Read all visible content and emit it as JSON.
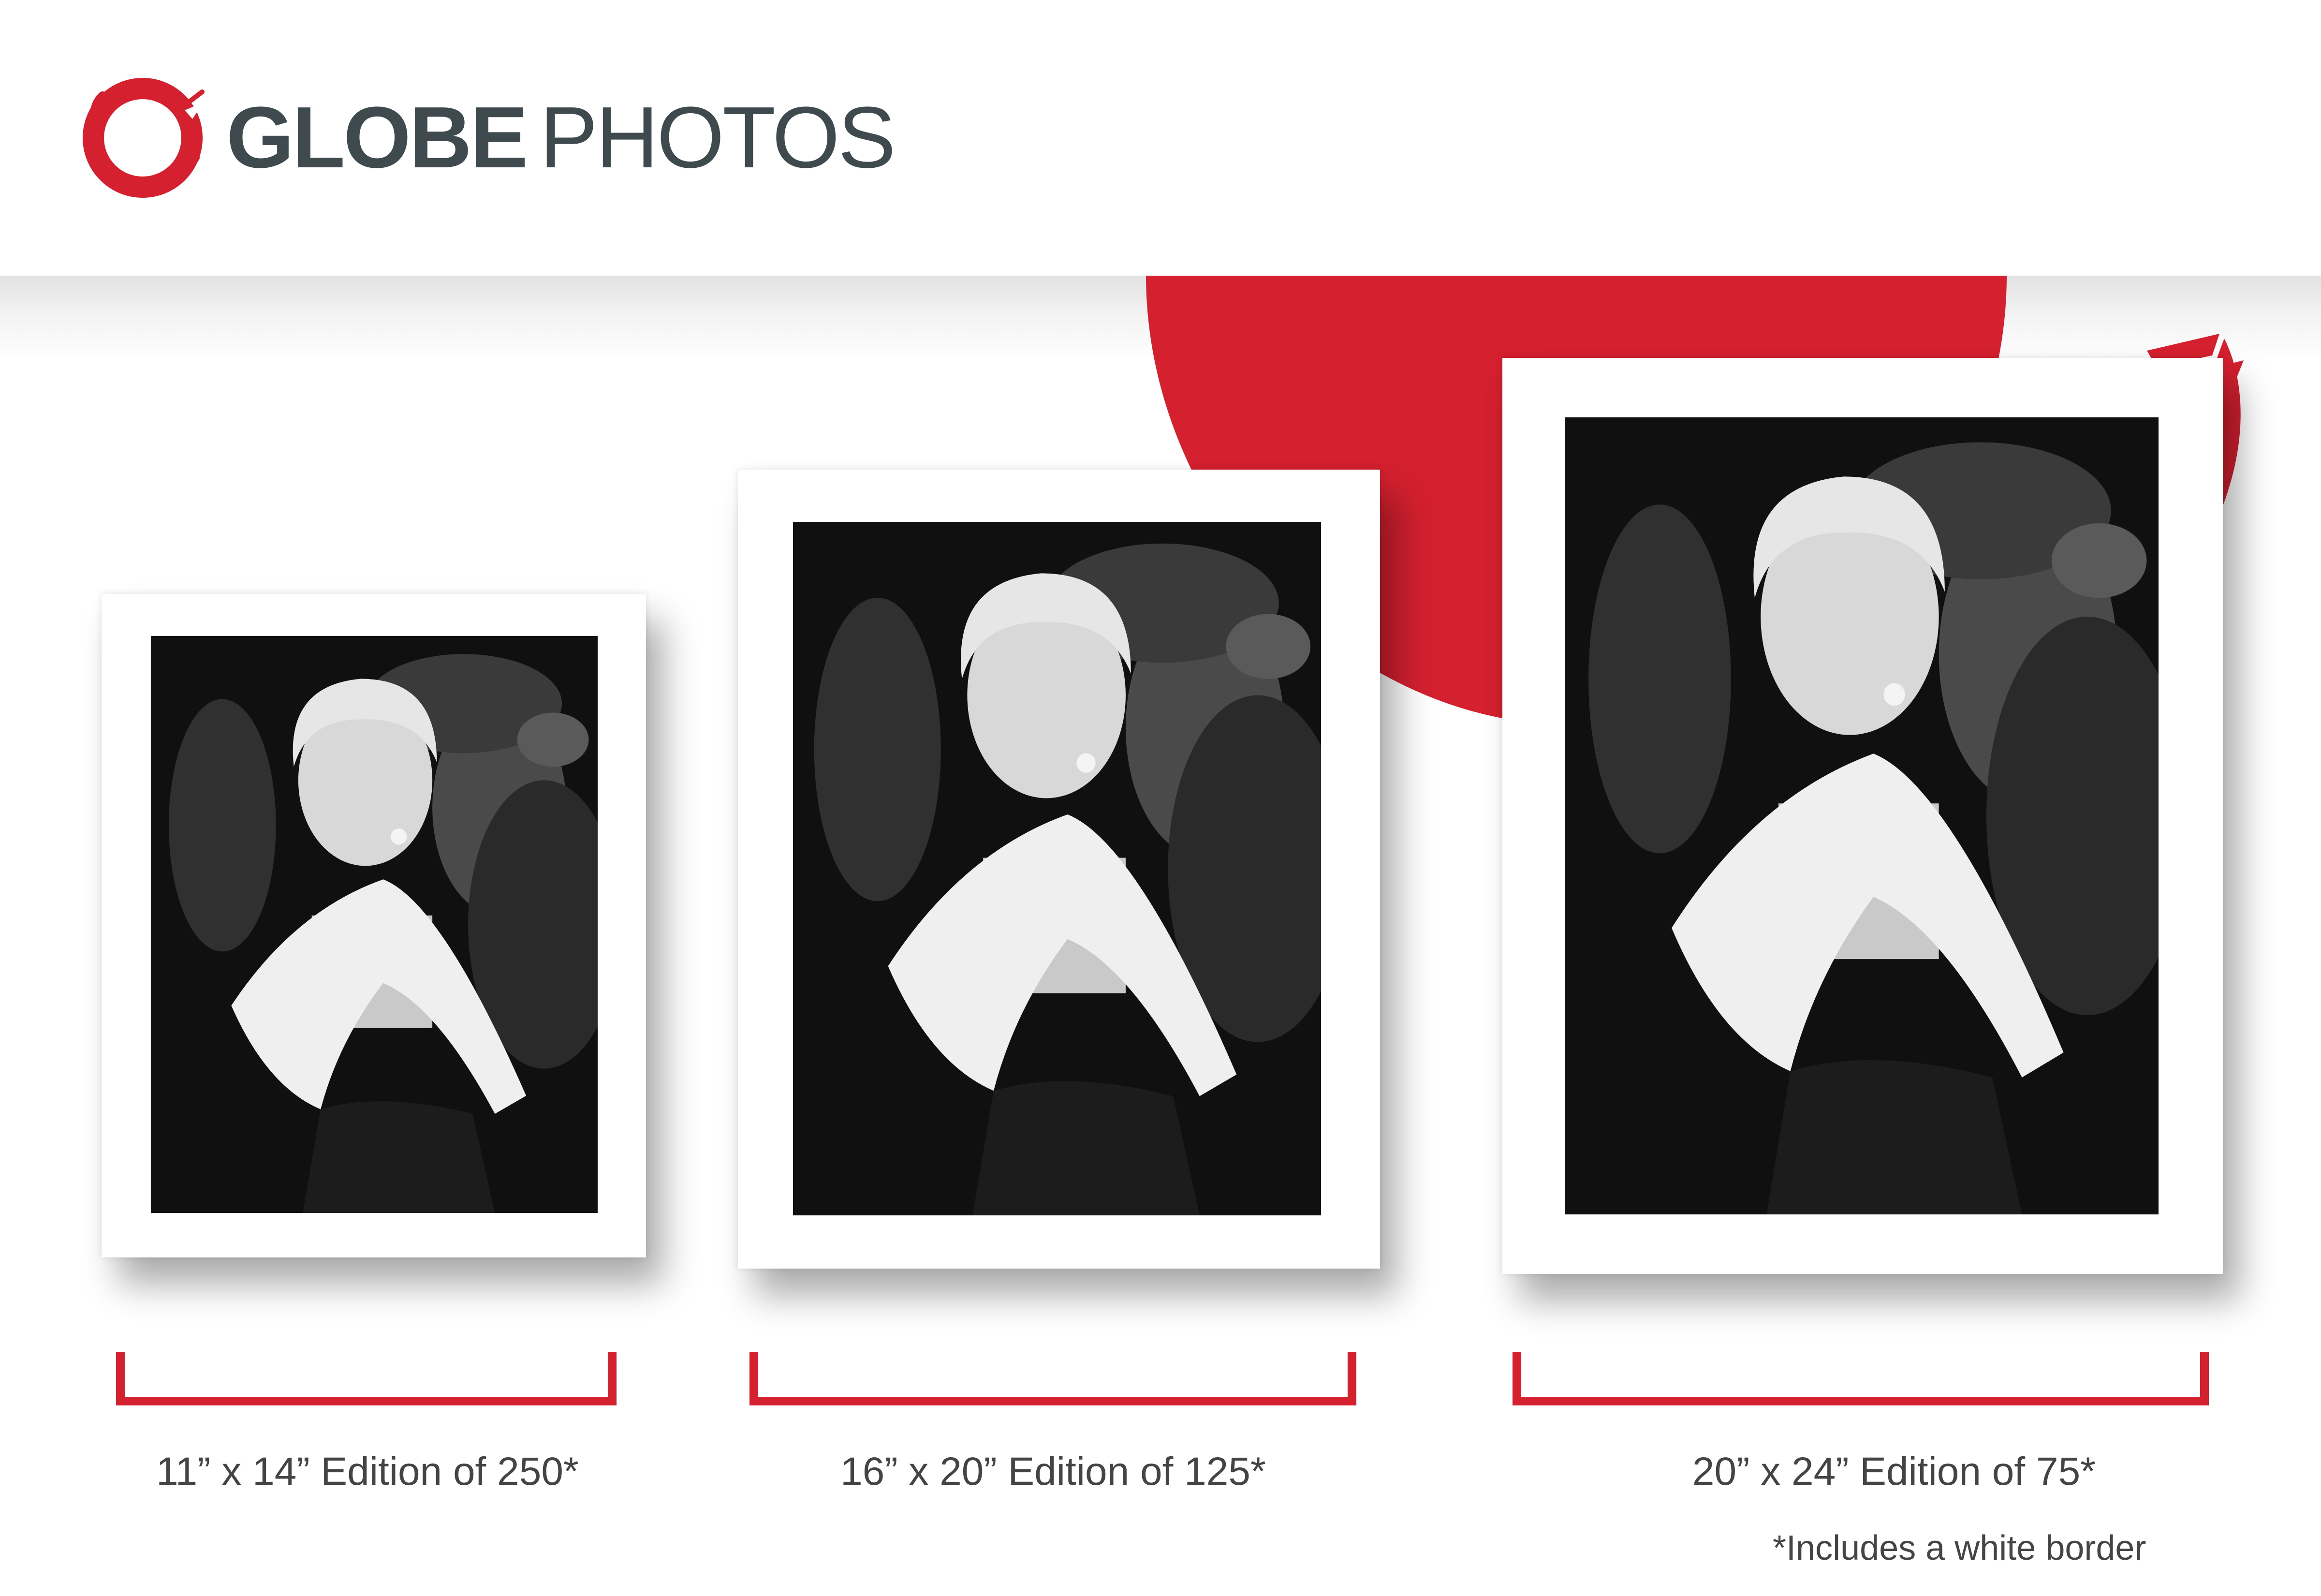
{
  "brand": {
    "name_bold": "GLOBE",
    "name_light": "PHOTOS",
    "logo_icon": "red-ring-brush-icon",
    "accent_color": "#d4202f",
    "text_color": "#3f4a4e"
  },
  "prints": [
    {
      "size_label": "11” x 14” Edition of 250*"
    },
    {
      "size_label": "16” x 20” Edition of 125*"
    },
    {
      "size_label": "20” x 24” Edition of 75*"
    }
  ],
  "footnote": "*Includes a white border"
}
